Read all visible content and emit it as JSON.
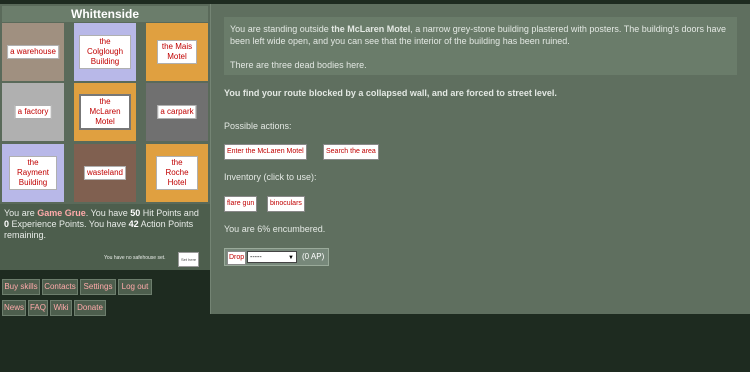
{
  "map": {
    "title": "Whittenside",
    "cells": [
      {
        "label": "a warehouse",
        "color": "#a09080"
      },
      {
        "label": "the Colglough Building",
        "color": "#b8b8e8"
      },
      {
        "label": "the Mais Motel",
        "color": "#e0a040"
      },
      {
        "label": "a factory",
        "color": "#b0b0b0"
      },
      {
        "label": "the McLaren Motel",
        "color": "#e0a040"
      },
      {
        "label": "a carpark",
        "color": "#707070"
      },
      {
        "label": "the Rayment Building",
        "color": "#b8b8e8"
      },
      {
        "label": "wasteland",
        "color": "#806050"
      },
      {
        "label": "the Roche Hotel",
        "color": "#e0a040"
      }
    ]
  },
  "status": {
    "p1": "You are ",
    "name": "Game Grue",
    "p2": ". You have ",
    "hp": "50",
    "p3": " Hit Points and ",
    "xp": "0",
    "p4": " Experience Points. You have ",
    "ap": "42",
    "p5": " Action Points remaining.",
    "safehouse": "You have no safehouse set.",
    "set_here": "Set here"
  },
  "nav": {
    "buy_skills": "Buy skills",
    "contacts": "Contacts",
    "settings": "Settings",
    "logout": "Log out",
    "news": "News",
    "faq": "FAQ",
    "wiki": "Wiki",
    "donate": "Donate"
  },
  "description": {
    "a": "You are standing outside ",
    "place": "the McLaren Motel",
    "b": ", a narrow grey-stone building plastered with posters. The building's doors have been left wide open, and you can see that the interior of the building has been ruined.",
    "bodies": "There are three dead bodies here."
  },
  "route_message": "You find your route blocked by a collapsed wall, and are forced to street level.",
  "actions": {
    "label": "Possible actions:",
    "enter": "Enter the McLaren Motel",
    "search": "Search the area"
  },
  "inventory": {
    "label": "Inventory (click to use):",
    "items": [
      "flare gun",
      "binoculars"
    ]
  },
  "encumbrance": "You are 6% encumbered.",
  "drop": {
    "button": "Drop",
    "selected": "-----",
    "ap_cost": "(0 AP)"
  },
  "colors": {
    "link_red": "#c00000",
    "highlight_pink": "#ffaaaa",
    "panel_green": "#5f6f5f"
  }
}
